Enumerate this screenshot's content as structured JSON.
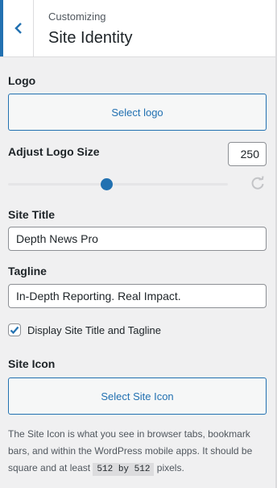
{
  "header": {
    "back_label": "Back",
    "customizing": "Customizing",
    "title": "Site Identity"
  },
  "logo": {
    "label": "Logo",
    "button": "Select logo"
  },
  "logo_size": {
    "label": "Adjust Logo Size",
    "value": "250",
    "slider_fraction": 0.45
  },
  "site_title": {
    "label": "Site Title",
    "value": "Depth News Pro"
  },
  "tagline": {
    "label": "Tagline",
    "value": "In-Depth Reporting. Real Impact."
  },
  "display_title": {
    "label": "Display Site Title and Tagline",
    "checked": true
  },
  "site_icon": {
    "label": "Site Icon",
    "button": "Select Site Icon",
    "description_pre": "The Site Icon is what you see in browser tabs, bookmark bars, and within the WordPress mobile apps. It should be square and at least",
    "description_code": "512 by 512",
    "description_post": "pixels."
  },
  "colors": {
    "accent": "#2271b1",
    "background": "#f0f0f1"
  }
}
